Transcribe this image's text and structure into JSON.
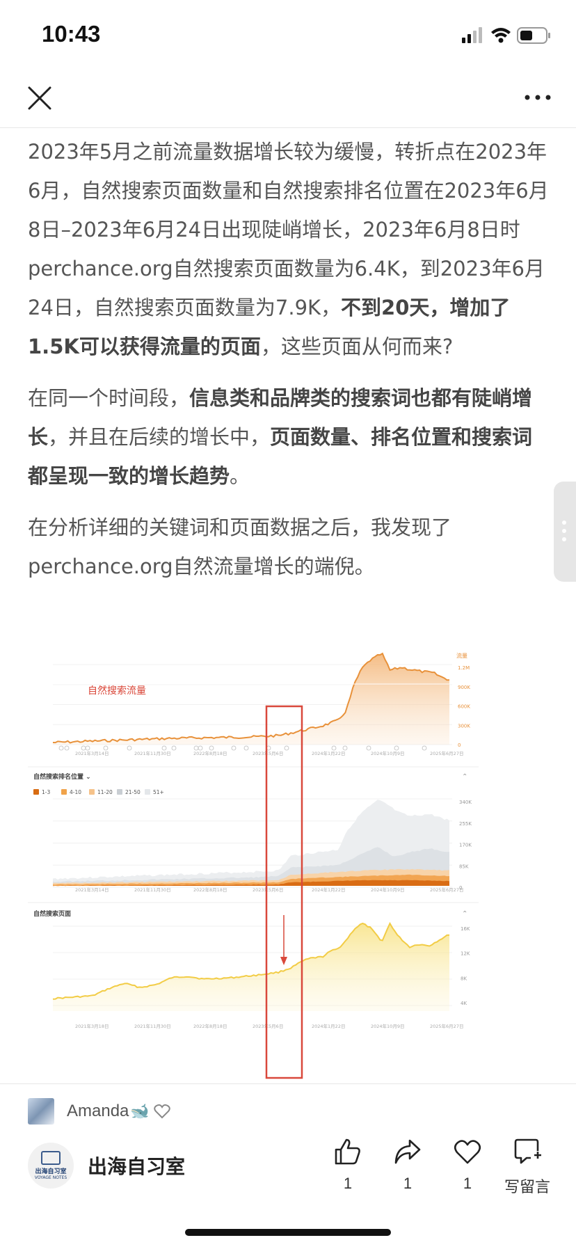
{
  "status_bar": {
    "time": "10:43"
  },
  "nav": {
    "close_icon": "close-icon",
    "more_icon": "more-icon"
  },
  "article": {
    "p1_a": "2023年5月之前流量数据增长较为缓慢，转折点在2023年6月，自然搜索页面数量和自然搜索排名位置在2023年6月8日–2023年6月24日出现陡峭增长，2023年6月8日时perchance.org自然搜索页面数量为6.4K，到2023年6月24日，自然搜索页面数量为7.9K，",
    "p1_b": "不到20天，增加了1.5K可以获得流量的页面",
    "p1_c": "，这些页面从何而来?",
    "p2_a": "在同一个时间段，",
    "p2_b": "信息类和品牌类的搜索词也都有陡峭增长",
    "p2_c": "，并且在后续的增长中，",
    "p2_d": "页面数量、排名位置和搜索词都呈现一致的增长趋势",
    "p2_e": "。",
    "p3": "在分析详细的关键词和页面数据之后，我发现了perchance.org自然流量增长的端倪。"
  },
  "figure": {
    "annotation": "自然搜索流量",
    "panel1": {
      "right_header": "流量",
      "y_ticks": [
        "1.2M",
        "900K",
        "600K",
        "300K",
        "0"
      ],
      "x_ticks": [
        "2021年3月14日",
        "2021年11月30日",
        "2022年8月18日",
        "2023年5月6日",
        "2024年1月22日",
        "2024年10月9日",
        "2025年6月27日"
      ]
    },
    "panel2": {
      "title": "自然搜索排名位置 ⌄",
      "legend": [
        "1-3",
        "4-10",
        "11-20",
        "21-50",
        "51+"
      ],
      "legend_colors": [
        "#d86c12",
        "#f0a34a",
        "#f5c28a",
        "#c9ced3",
        "#e4e7ea"
      ],
      "y_ticks": [
        "340K",
        "255K",
        "170K",
        "85K",
        "0"
      ],
      "x_ticks": [
        "2021年3月14日",
        "2021年11月30日",
        "2022年8月18日",
        "2023年5月6日",
        "2024年1月22日",
        "2024年10月9日",
        "2025年6月27日"
      ]
    },
    "panel3": {
      "title": "自然搜索页面",
      "y_ticks": [
        "16K",
        "12K",
        "8K",
        "4K"
      ],
      "x_ticks": [
        "2021年3月18日",
        "2021年11月30日",
        "2022年8月18日",
        "2023年5月6日",
        "2024年1月22日",
        "2024年10月9日",
        "2025年6月27日"
      ]
    },
    "colors": {
      "traffic": "#e8913a",
      "pages": "#f2cc45",
      "highlight": "#d9483b"
    }
  },
  "bottom": {
    "author_name": "Amanda",
    "author_emoji": "🐋",
    "account_name": "出海自习室",
    "avatar_text": "出海自习室",
    "avatar_sub": "VOYAGE NOTES",
    "like_count": "1",
    "share_count": "1",
    "fav_count": "1",
    "comment_label": "写留言"
  }
}
